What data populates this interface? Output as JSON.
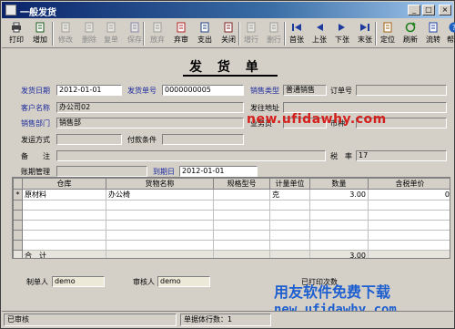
{
  "window": {
    "title": "一般发货"
  },
  "titlebar_controls": {
    "minimize": "_",
    "maximize": "□",
    "close": "×"
  },
  "toolbar": [
    {
      "name": "print",
      "label": "打印",
      "icon": "printer-icon",
      "enabled": true
    },
    {
      "name": "add",
      "label": "增加",
      "icon": "add-doc-icon",
      "enabled": true
    },
    {
      "name": "edit",
      "label": "修改",
      "icon": "edit-icon",
      "enabled": false
    },
    {
      "name": "delete",
      "label": "删除",
      "icon": "delete-icon",
      "enabled": false
    },
    {
      "name": "copy",
      "label": "复单",
      "icon": "copy-icon",
      "enabled": false
    },
    {
      "name": "save",
      "label": "保存",
      "icon": "save-icon",
      "enabled": false
    },
    {
      "name": "discard",
      "label": "放弃",
      "icon": "discard-icon",
      "enabled": false
    },
    {
      "name": "unapprove",
      "label": "弃审",
      "icon": "unapprove-icon",
      "enabled": true
    },
    {
      "name": "ship",
      "label": "支出",
      "icon": "ship-icon",
      "enabled": true
    },
    {
      "name": "close",
      "label": "关闭",
      "icon": "close-doc-icon",
      "enabled": true
    },
    {
      "name": "add-row",
      "label": "增行",
      "icon": "add-row-icon",
      "enabled": false
    },
    {
      "name": "del-row",
      "label": "删行",
      "icon": "del-row-icon",
      "enabled": false
    },
    {
      "name": "first",
      "label": "首张",
      "icon": "first-icon",
      "enabled": true
    },
    {
      "name": "prev",
      "label": "上张",
      "icon": "prev-icon",
      "enabled": true
    },
    {
      "name": "next",
      "label": "下张",
      "icon": "next-icon",
      "enabled": true
    },
    {
      "name": "last",
      "label": "末张",
      "icon": "last-icon",
      "enabled": true
    },
    {
      "name": "locate",
      "label": "定位",
      "icon": "locate-icon",
      "enabled": true
    },
    {
      "name": "refresh",
      "label": "刷新",
      "icon": "refresh-icon",
      "enabled": true
    },
    {
      "name": "flow",
      "label": "流转",
      "icon": "flow-icon",
      "enabled": true
    },
    {
      "name": "help",
      "label": "帮助",
      "icon": "help-icon",
      "enabled": true
    }
  ],
  "form": {
    "title": "发 货 单",
    "fields": {
      "ship_date_label": "发货日期",
      "ship_date": "2012-01-01",
      "ship_no_label": "发货单号",
      "ship_no": "0000000005",
      "sale_type_label": "销售类型",
      "sale_type": "普通销售",
      "order_no_label": "订单号",
      "order_no": "",
      "customer_label": "客户名称",
      "customer": "办公司02",
      "ship_addr_label": "发往地址",
      "ship_addr": "",
      "dept_label": "销售部门",
      "dept": "销售部",
      "salesman_label": "业务员",
      "salesman": "",
      "currency_label": "币种",
      "currency": "",
      "ship_method_label": "发运方式",
      "ship_method": "",
      "pay_terms_label": "付款条件",
      "pay_terms": "",
      "remark_label": "备　　注",
      "remark": "",
      "tax_rate_label": "税　率",
      "tax_rate": "17",
      "account_label": "账期管理",
      "account": "",
      "due_date_label": "到期日",
      "due_date": "2012-01-01"
    },
    "grid": {
      "columns": [
        "仓库",
        "货物名称",
        "规格型号",
        "计量单位",
        "数量",
        "含税单价"
      ],
      "rows": [
        {
          "marker": "*",
          "cells": [
            "原材料",
            "办公椅",
            "",
            "克",
            "3.00",
            "0"
          ]
        },
        {
          "marker": "",
          "cells": [
            "",
            "",
            "",
            "",
            "",
            ""
          ]
        },
        {
          "marker": "",
          "cells": [
            "",
            "",
            "",
            "",
            "",
            ""
          ]
        },
        {
          "marker": "",
          "cells": [
            "",
            "",
            "",
            "",
            "",
            ""
          ]
        },
        {
          "marker": "",
          "cells": [
            "",
            "",
            "",
            "",
            "",
            ""
          ]
        },
        {
          "marker": "",
          "cells": [
            "",
            "",
            "",
            "",
            "",
            ""
          ]
        }
      ],
      "total": {
        "label": "合　计",
        "qty": "3.00"
      }
    },
    "footer": {
      "maker_label": "制单人",
      "maker": "demo",
      "approver_label": "审核人",
      "approver": "demo",
      "printed_label": "已打印次数",
      "printed": ""
    }
  },
  "watermarks": {
    "url_red": "new.ufidawhy.com",
    "brand_blue": "用友软件免费下载",
    "url_blue": "new.ufidawhy.com"
  },
  "statusbar": {
    "approved": "已审核",
    "row_count": "单据体行数：1"
  }
}
